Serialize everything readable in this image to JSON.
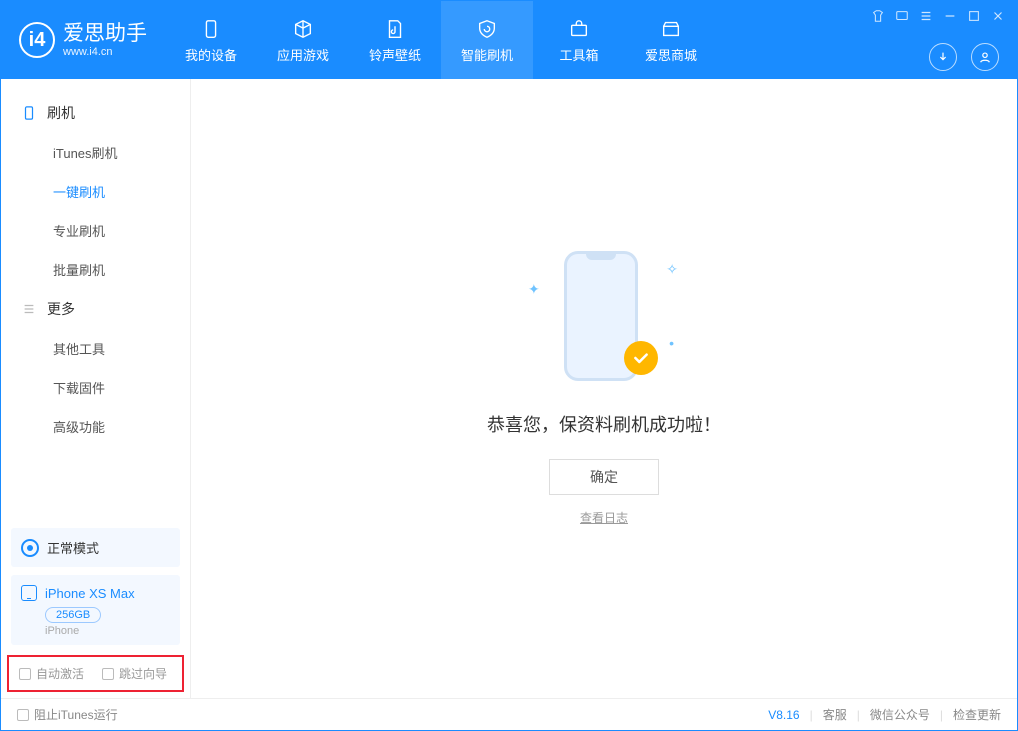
{
  "header": {
    "logo_title": "爱思助手",
    "logo_sub": "www.i4.cn",
    "nav": [
      {
        "label": "我的设备"
      },
      {
        "label": "应用游戏"
      },
      {
        "label": "铃声壁纸"
      },
      {
        "label": "智能刷机"
      },
      {
        "label": "工具箱"
      },
      {
        "label": "爱思商城"
      }
    ]
  },
  "sidebar": {
    "cat1": "刷机",
    "items1": [
      {
        "label": "iTunes刷机"
      },
      {
        "label": "一键刷机"
      },
      {
        "label": "专业刷机"
      },
      {
        "label": "批量刷机"
      }
    ],
    "cat2": "更多",
    "items2": [
      {
        "label": "其他工具"
      },
      {
        "label": "下载固件"
      },
      {
        "label": "高级功能"
      }
    ],
    "mode_label": "正常模式",
    "device_name": "iPhone XS Max",
    "device_capacity": "256GB",
    "device_sub": "iPhone",
    "chk_auto_activate": "自动激活",
    "chk_skip_guide": "跳过向导"
  },
  "main": {
    "success_text": "恭喜您，保资料刷机成功啦！",
    "ok_button": "确定",
    "view_log": "查看日志"
  },
  "footer": {
    "block_itunes": "阻止iTunes运行",
    "version": "V8.16",
    "links": [
      "客服",
      "微信公众号",
      "检查更新"
    ]
  }
}
